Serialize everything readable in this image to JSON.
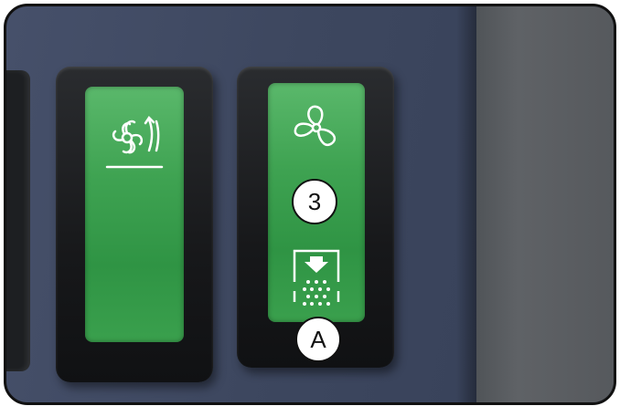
{
  "colors": {
    "switch_green": "#3fa352",
    "housing_black": "#17181a",
    "panel_blue": "#3f4a62",
    "icon_white": "#ffffff"
  },
  "icons": {
    "switch_left": "fan-recirculation-icon",
    "switch_right_top": "fan-icon",
    "switch_right_bottom": "defrost-vent-icon"
  },
  "callouts": {
    "number_label": "3",
    "letter_label": "A"
  }
}
